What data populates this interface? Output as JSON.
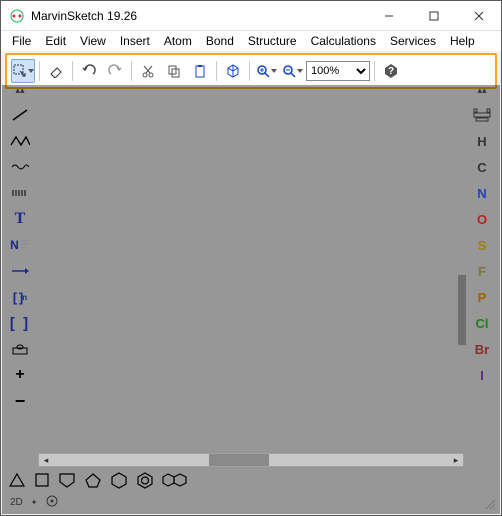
{
  "title": "MarvinSketch 19.26",
  "menu": {
    "file": "File",
    "edit": "Edit",
    "view": "View",
    "insert": "Insert",
    "atom": "Atom",
    "bond": "Bond",
    "structure": "Structure",
    "calculations": "Calculations",
    "services": "Services",
    "help": "Help"
  },
  "toolbar": {
    "zoom_value": "100%"
  },
  "left_tools": {
    "text_tool": "T",
    "name_tool": "N",
    "bracket_n": "[ ]",
    "bracket": "[ ]",
    "plus": "+",
    "minus": "−"
  },
  "elements": {
    "H": "H",
    "C": "C",
    "N": "N",
    "O": "O",
    "S": "S",
    "F": "F",
    "P": "P",
    "Cl": "Cl",
    "Br": "Br",
    "I": "I"
  },
  "status": {
    "mode": "2D",
    "sel": "✦"
  }
}
